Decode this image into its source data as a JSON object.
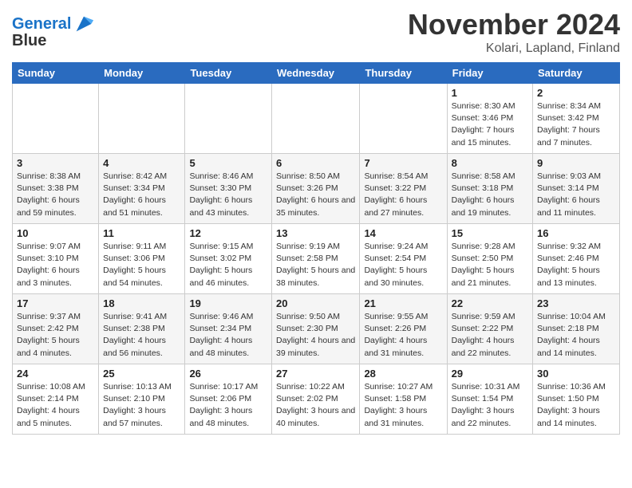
{
  "header": {
    "logo_line1": "General",
    "logo_line2": "Blue",
    "month_title": "November 2024",
    "location": "Kolari, Lapland, Finland"
  },
  "weekdays": [
    "Sunday",
    "Monday",
    "Tuesday",
    "Wednesday",
    "Thursday",
    "Friday",
    "Saturday"
  ],
  "weeks": [
    [
      {
        "day": "",
        "sunrise": "",
        "sunset": "",
        "daylight": ""
      },
      {
        "day": "",
        "sunrise": "",
        "sunset": "",
        "daylight": ""
      },
      {
        "day": "",
        "sunrise": "",
        "sunset": "",
        "daylight": ""
      },
      {
        "day": "",
        "sunrise": "",
        "sunset": "",
        "daylight": ""
      },
      {
        "day": "",
        "sunrise": "",
        "sunset": "",
        "daylight": ""
      },
      {
        "day": "1",
        "sunrise": "Sunrise: 8:30 AM",
        "sunset": "Sunset: 3:46 PM",
        "daylight": "Daylight: 7 hours and 15 minutes."
      },
      {
        "day": "2",
        "sunrise": "Sunrise: 8:34 AM",
        "sunset": "Sunset: 3:42 PM",
        "daylight": "Daylight: 7 hours and 7 minutes."
      }
    ],
    [
      {
        "day": "3",
        "sunrise": "Sunrise: 8:38 AM",
        "sunset": "Sunset: 3:38 PM",
        "daylight": "Daylight: 6 hours and 59 minutes."
      },
      {
        "day": "4",
        "sunrise": "Sunrise: 8:42 AM",
        "sunset": "Sunset: 3:34 PM",
        "daylight": "Daylight: 6 hours and 51 minutes."
      },
      {
        "day": "5",
        "sunrise": "Sunrise: 8:46 AM",
        "sunset": "Sunset: 3:30 PM",
        "daylight": "Daylight: 6 hours and 43 minutes."
      },
      {
        "day": "6",
        "sunrise": "Sunrise: 8:50 AM",
        "sunset": "Sunset: 3:26 PM",
        "daylight": "Daylight: 6 hours and 35 minutes."
      },
      {
        "day": "7",
        "sunrise": "Sunrise: 8:54 AM",
        "sunset": "Sunset: 3:22 PM",
        "daylight": "Daylight: 6 hours and 27 minutes."
      },
      {
        "day": "8",
        "sunrise": "Sunrise: 8:58 AM",
        "sunset": "Sunset: 3:18 PM",
        "daylight": "Daylight: 6 hours and 19 minutes."
      },
      {
        "day": "9",
        "sunrise": "Sunrise: 9:03 AM",
        "sunset": "Sunset: 3:14 PM",
        "daylight": "Daylight: 6 hours and 11 minutes."
      }
    ],
    [
      {
        "day": "10",
        "sunrise": "Sunrise: 9:07 AM",
        "sunset": "Sunset: 3:10 PM",
        "daylight": "Daylight: 6 hours and 3 minutes."
      },
      {
        "day": "11",
        "sunrise": "Sunrise: 9:11 AM",
        "sunset": "Sunset: 3:06 PM",
        "daylight": "Daylight: 5 hours and 54 minutes."
      },
      {
        "day": "12",
        "sunrise": "Sunrise: 9:15 AM",
        "sunset": "Sunset: 3:02 PM",
        "daylight": "Daylight: 5 hours and 46 minutes."
      },
      {
        "day": "13",
        "sunrise": "Sunrise: 9:19 AM",
        "sunset": "Sunset: 2:58 PM",
        "daylight": "Daylight: 5 hours and 38 minutes."
      },
      {
        "day": "14",
        "sunrise": "Sunrise: 9:24 AM",
        "sunset": "Sunset: 2:54 PM",
        "daylight": "Daylight: 5 hours and 30 minutes."
      },
      {
        "day": "15",
        "sunrise": "Sunrise: 9:28 AM",
        "sunset": "Sunset: 2:50 PM",
        "daylight": "Daylight: 5 hours and 21 minutes."
      },
      {
        "day": "16",
        "sunrise": "Sunrise: 9:32 AM",
        "sunset": "Sunset: 2:46 PM",
        "daylight": "Daylight: 5 hours and 13 minutes."
      }
    ],
    [
      {
        "day": "17",
        "sunrise": "Sunrise: 9:37 AM",
        "sunset": "Sunset: 2:42 PM",
        "daylight": "Daylight: 5 hours and 4 minutes."
      },
      {
        "day": "18",
        "sunrise": "Sunrise: 9:41 AM",
        "sunset": "Sunset: 2:38 PM",
        "daylight": "Daylight: 4 hours and 56 minutes."
      },
      {
        "day": "19",
        "sunrise": "Sunrise: 9:46 AM",
        "sunset": "Sunset: 2:34 PM",
        "daylight": "Daylight: 4 hours and 48 minutes."
      },
      {
        "day": "20",
        "sunrise": "Sunrise: 9:50 AM",
        "sunset": "Sunset: 2:30 PM",
        "daylight": "Daylight: 4 hours and 39 minutes."
      },
      {
        "day": "21",
        "sunrise": "Sunrise: 9:55 AM",
        "sunset": "Sunset: 2:26 PM",
        "daylight": "Daylight: 4 hours and 31 minutes."
      },
      {
        "day": "22",
        "sunrise": "Sunrise: 9:59 AM",
        "sunset": "Sunset: 2:22 PM",
        "daylight": "Daylight: 4 hours and 22 minutes."
      },
      {
        "day": "23",
        "sunrise": "Sunrise: 10:04 AM",
        "sunset": "Sunset: 2:18 PM",
        "daylight": "Daylight: 4 hours and 14 minutes."
      }
    ],
    [
      {
        "day": "24",
        "sunrise": "Sunrise: 10:08 AM",
        "sunset": "Sunset: 2:14 PM",
        "daylight": "Daylight: 4 hours and 5 minutes."
      },
      {
        "day": "25",
        "sunrise": "Sunrise: 10:13 AM",
        "sunset": "Sunset: 2:10 PM",
        "daylight": "Daylight: 3 hours and 57 minutes."
      },
      {
        "day": "26",
        "sunrise": "Sunrise: 10:17 AM",
        "sunset": "Sunset: 2:06 PM",
        "daylight": "Daylight: 3 hours and 48 minutes."
      },
      {
        "day": "27",
        "sunrise": "Sunrise: 10:22 AM",
        "sunset": "Sunset: 2:02 PM",
        "daylight": "Daylight: 3 hours and 40 minutes."
      },
      {
        "day": "28",
        "sunrise": "Sunrise: 10:27 AM",
        "sunset": "Sunset: 1:58 PM",
        "daylight": "Daylight: 3 hours and 31 minutes."
      },
      {
        "day": "29",
        "sunrise": "Sunrise: 10:31 AM",
        "sunset": "Sunset: 1:54 PM",
        "daylight": "Daylight: 3 hours and 22 minutes."
      },
      {
        "day": "30",
        "sunrise": "Sunrise: 10:36 AM",
        "sunset": "Sunset: 1:50 PM",
        "daylight": "Daylight: 3 hours and 14 minutes."
      }
    ]
  ]
}
